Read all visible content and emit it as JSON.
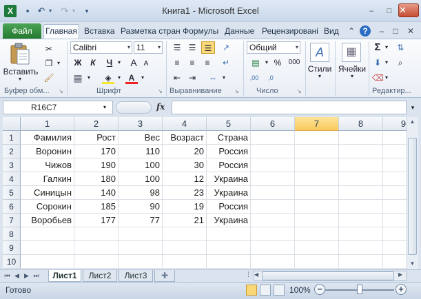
{
  "window": {
    "title": "Книга1  -  Microsoft Excel",
    "app_letter": "X",
    "minimize_glyph": "–",
    "restore_glyph": "□",
    "close_glyph": "✕"
  },
  "quick_access": {
    "save_glyph": "▪",
    "undo_glyph": "↶",
    "redo_glyph": "↷",
    "more_glyph": "▾"
  },
  "ribbon_tabs": {
    "file": "Файл",
    "home": "Главная",
    "insert": "Вставка",
    "layout": "Разметка стран",
    "formulas": "Формулы",
    "data": "Данные",
    "review": "Рецензировані",
    "view": "Вид",
    "help": "?"
  },
  "clipboard": {
    "paste_label": "Вставить",
    "group_label": "Буфер обм..."
  },
  "font": {
    "name": "Calibri",
    "size": "11",
    "bold": "Ж",
    "italic": "К",
    "underline": "Ч",
    "grow": "A",
    "shrink": "A",
    "group_label": "Шрифт"
  },
  "alignment": {
    "group_label": "Выравнивание"
  },
  "number": {
    "format": "Общий",
    "percent": "%",
    "thousands": "000",
    "inc_dec": ",00",
    "dec_dec": ",0",
    "group_label": "Число"
  },
  "styles": {
    "label": "Стили"
  },
  "cells": {
    "label": "Ячейки"
  },
  "editing": {
    "sum": "Σ",
    "group_label": "Редактир..."
  },
  "formula_bar": {
    "name_box": "R16C7",
    "fx": "fx",
    "formula": ""
  },
  "grid": {
    "columns": [
      "1",
      "2",
      "3",
      "4",
      "5",
      "6",
      "7",
      "8",
      "9"
    ],
    "selected_column": "7",
    "rows": [
      "1",
      "2",
      "3",
      "4",
      "5",
      "6",
      "7",
      "8",
      "9",
      "10"
    ],
    "data": [
      [
        "Фамилия",
        "Рост",
        "Вес",
        "Возраст",
        "Страна"
      ],
      [
        "Воронин",
        "170",
        "110",
        "20",
        "Россия"
      ],
      [
        "Чижов",
        "190",
        "100",
        "30",
        "Россия"
      ],
      [
        "Галкин",
        "180",
        "100",
        "12",
        "Украина"
      ],
      [
        "Синицын",
        "140",
        "98",
        "23",
        "Украина"
      ],
      [
        "Сорокин",
        "185",
        "90",
        "19",
        "Россия"
      ],
      [
        "Воробьев",
        "177",
        "77",
        "21",
        "Украина"
      ]
    ]
  },
  "sheets": [
    "Лист1",
    "Лист2",
    "Лист3"
  ],
  "active_sheet": "Лист1",
  "status": {
    "ready": "Готово",
    "zoom": "100%",
    "zoom_fraction": 0.5
  }
}
